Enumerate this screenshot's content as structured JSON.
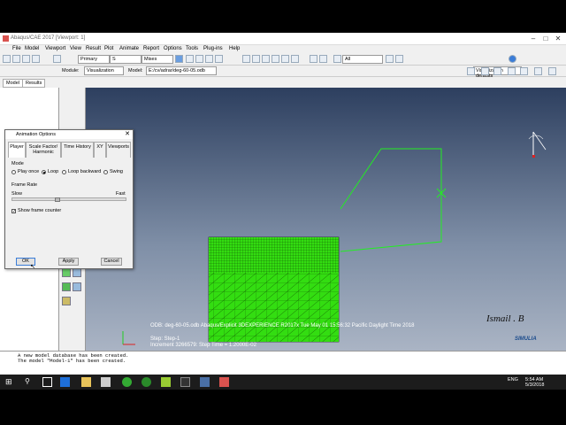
{
  "window": {
    "title": "Abaqus/CAE 2017 [Viewport: 1]"
  },
  "menu": [
    "File",
    "Model",
    "Viewport",
    "View",
    "Result",
    "Plot",
    "Animate",
    "Report",
    "Options",
    "Tools",
    "Plug-ins",
    "Help"
  ],
  "toolbar": {
    "primary_combo": "Primary",
    "s_combo": "S",
    "mises_combo": "Mises",
    "all_combo": "All",
    "visualization_defaults": "Visualization defaults"
  },
  "context": {
    "module_label": "Module:",
    "module_value": "Visualization",
    "model_label": "Model:",
    "model_value": "E:/cv/adrar/deg-60-05.odb"
  },
  "tabs": {
    "model": "Model",
    "results": "Results"
  },
  "dialog": {
    "title": "Animation Options",
    "tabs": [
      "Player",
      "Scale Factor/ Harmonic",
      "Time History",
      "XY",
      "Viewports"
    ],
    "mode_label": "Mode",
    "modes": [
      "Play once",
      "Loop",
      "Loop backward",
      "Swing"
    ],
    "selected_mode": "Loop",
    "frame_rate_label": "Frame Rate",
    "slow": "Slow",
    "fast": "Fast",
    "show_frame_counter": "Show frame counter",
    "show_frame_counter_checked": true,
    "ok": "OK",
    "apply": "Apply",
    "cancel": "Cancel"
  },
  "viewport": {
    "odb_line": "ODB: deg-60-05.odb    Abaqus/Explicit 3DEXPERIENCE R2017x    Tue May 01 15:56:32 Pacific Daylight Time 2018",
    "step_line": "Step: Step-1",
    "increment_line": "Increment    3266579: Step Time =    1.2000E-02",
    "signature": "Ismail . B",
    "brand": "SIMULIA",
    "mesh_color": "#33dd11",
    "outline_color": "#22ee22"
  },
  "messages": [
    "A new model database has been created.",
    "The model \"Model-1\" has been created."
  ],
  "taskbar": {
    "time": "5:54 AM",
    "date": "5/3/2018",
    "lang": "ENG"
  }
}
